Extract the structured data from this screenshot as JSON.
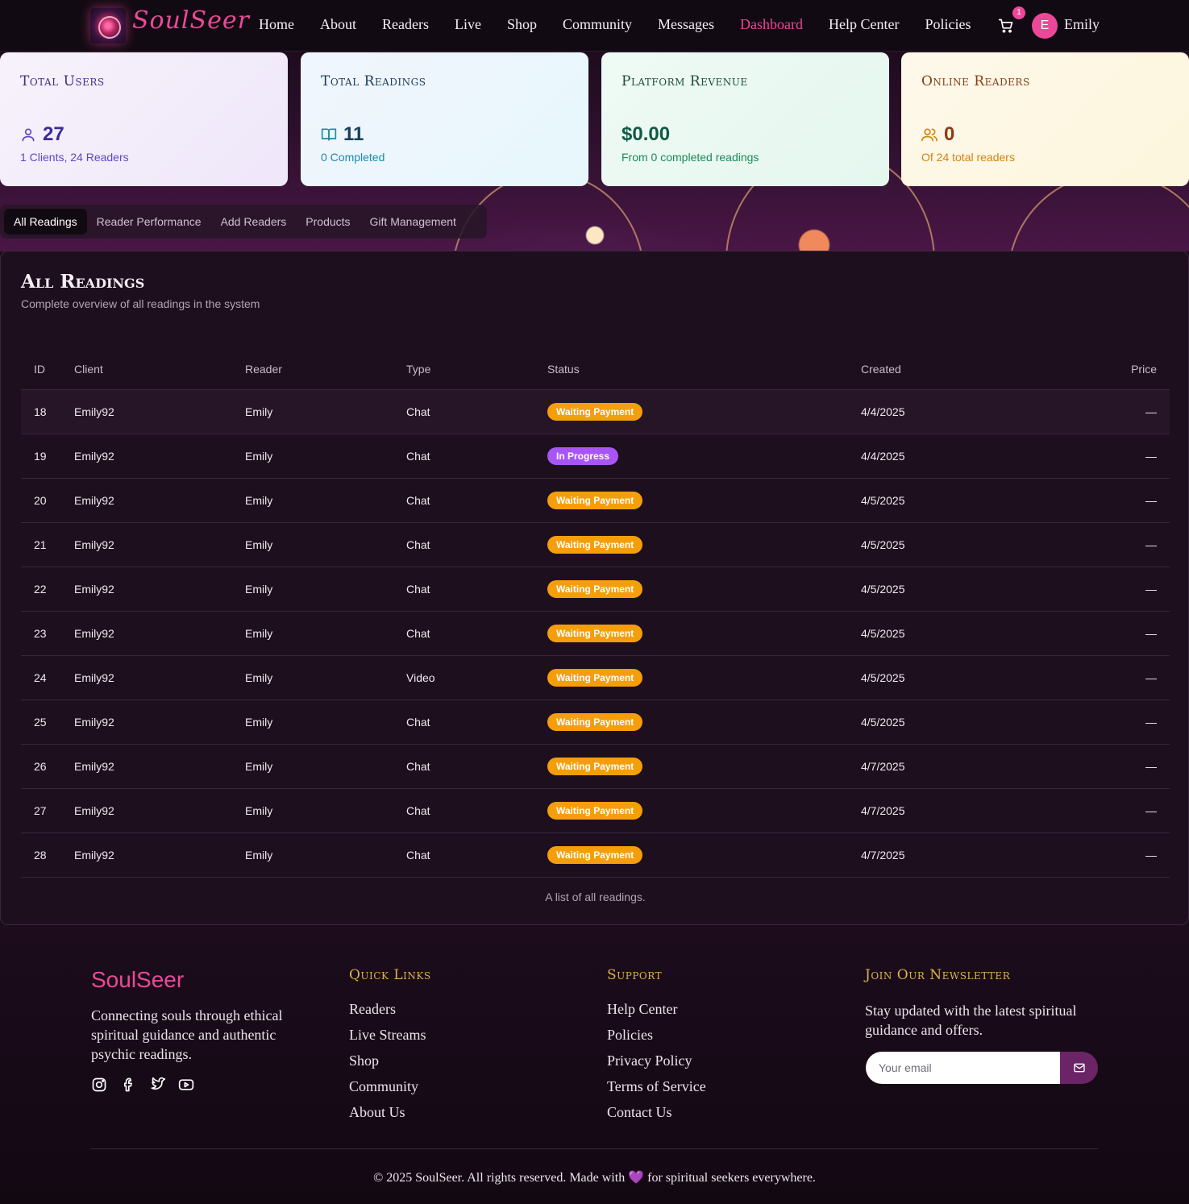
{
  "brand": {
    "logo_text": "SoulSeer"
  },
  "nav": {
    "links": [
      "Home",
      "About",
      "Readers",
      "Live",
      "Shop",
      "Community",
      "Messages",
      "Dashboard",
      "Help Center",
      "Policies"
    ],
    "active": "Dashboard",
    "cart_count": "1",
    "user_initial": "E",
    "user_name": "Emily"
  },
  "stats": {
    "users": {
      "title": "Total Users",
      "value": "27",
      "sub": "1 Clients, 24 Readers"
    },
    "readings": {
      "title": "Total Readings",
      "value": "11",
      "sub": "0 Completed"
    },
    "revenue": {
      "title": "Platform Revenue",
      "value": "$0.00",
      "sub": "From 0 completed readings"
    },
    "online": {
      "title": "Online Readers",
      "value": "0",
      "sub": "Of 24 total readers"
    }
  },
  "tabs": [
    "All Readings",
    "Reader Performance",
    "Add Readers",
    "Products",
    "Gift Management"
  ],
  "panel": {
    "title": "All Readings",
    "subtitle": "Complete overview of all readings in the system",
    "columns": [
      "ID",
      "Client",
      "Reader",
      "Type",
      "Status",
      "Created",
      "Price"
    ],
    "caption": "A list of all readings.",
    "rows": [
      {
        "id": "18",
        "client": "Emily92",
        "reader": "Emily",
        "type": "Chat",
        "status": "Waiting Payment",
        "created": "4/4/2025",
        "price": "—"
      },
      {
        "id": "19",
        "client": "Emily92",
        "reader": "Emily",
        "type": "Chat",
        "status": "In Progress",
        "created": "4/4/2025",
        "price": "—"
      },
      {
        "id": "20",
        "client": "Emily92",
        "reader": "Emily",
        "type": "Chat",
        "status": "Waiting Payment",
        "created": "4/5/2025",
        "price": "—"
      },
      {
        "id": "21",
        "client": "Emily92",
        "reader": "Emily",
        "type": "Chat",
        "status": "Waiting Payment",
        "created": "4/5/2025",
        "price": "—"
      },
      {
        "id": "22",
        "client": "Emily92",
        "reader": "Emily",
        "type": "Chat",
        "status": "Waiting Payment",
        "created": "4/5/2025",
        "price": "—"
      },
      {
        "id": "23",
        "client": "Emily92",
        "reader": "Emily",
        "type": "Chat",
        "status": "Waiting Payment",
        "created": "4/5/2025",
        "price": "—"
      },
      {
        "id": "24",
        "client": "Emily92",
        "reader": "Emily",
        "type": "Video",
        "status": "Waiting Payment",
        "created": "4/5/2025",
        "price": "—"
      },
      {
        "id": "25",
        "client": "Emily92",
        "reader": "Emily",
        "type": "Chat",
        "status": "Waiting Payment",
        "created": "4/5/2025",
        "price": "—"
      },
      {
        "id": "26",
        "client": "Emily92",
        "reader": "Emily",
        "type": "Chat",
        "status": "Waiting Payment",
        "created": "4/7/2025",
        "price": "—"
      },
      {
        "id": "27",
        "client": "Emily92",
        "reader": "Emily",
        "type": "Chat",
        "status": "Waiting Payment",
        "created": "4/7/2025",
        "price": "—"
      },
      {
        "id": "28",
        "client": "Emily92",
        "reader": "Emily",
        "type": "Chat",
        "status": "Waiting Payment",
        "created": "4/7/2025",
        "price": "—"
      }
    ]
  },
  "footer": {
    "brand": "SoulSeer",
    "description": "Connecting souls through ethical spiritual guidance and authentic psychic readings.",
    "social_icons": [
      "instagram-icon",
      "facebook-icon",
      "twitter-icon",
      "youtube-icon"
    ],
    "quick_links_title": "Quick Links",
    "quick_links": [
      "Readers",
      "Live Streams",
      "Shop",
      "Community",
      "About Us"
    ],
    "support_title": "Support",
    "support_links": [
      "Help Center",
      "Policies",
      "Privacy Policy",
      "Terms of Service",
      "Contact Us"
    ],
    "newsletter_title": "Join Our Newsletter",
    "newsletter_text": "Stay updated with the latest spiritual guidance and offers.",
    "newsletter_placeholder": "Your email",
    "copyright_before": "© 2025 SoulSeer. All rights reserved. Made with",
    "copyright_heart": "💜",
    "copyright_after": "for spiritual seekers everywhere."
  },
  "colors": {
    "accent_pink": "#ec4899",
    "waiting_badge": "#f59e0b",
    "progress_badge": "#a855f7",
    "footer_heading_gold": "#d9b44a"
  }
}
